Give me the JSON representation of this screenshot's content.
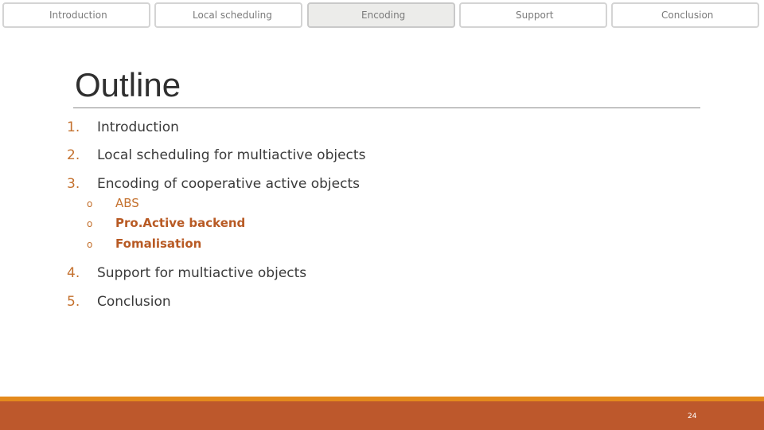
{
  "nav": {
    "tabs": [
      {
        "label": "Introduction",
        "active": false
      },
      {
        "label": "Local scheduling",
        "active": false
      },
      {
        "label": "Encoding",
        "active": true
      },
      {
        "label": "Support",
        "active": false
      },
      {
        "label": "Conclusion",
        "active": false
      }
    ]
  },
  "slide": {
    "title": "Outline",
    "items": [
      {
        "number": "1.",
        "label": "Introduction"
      },
      {
        "number": "2.",
        "label": "Local scheduling for multiactive objects"
      },
      {
        "number": "3.",
        "label": "Encoding of cooperative active objects",
        "subitems": [
          {
            "bullet": "o",
            "label": "ABS"
          },
          {
            "bullet": "o",
            "label": "Pro.Active backend"
          },
          {
            "bullet": "o",
            "label": "Fomalisation"
          }
        ]
      },
      {
        "number": "4.",
        "label": "Support for multiactive objects"
      },
      {
        "number": "5.",
        "label": "Conclusion"
      }
    ],
    "page_number": "24"
  },
  "colors": {
    "accent": "#c4712e",
    "footer": "#bd582c",
    "footer_stripe": "#e48a1d",
    "active_tab": "#ececea"
  }
}
